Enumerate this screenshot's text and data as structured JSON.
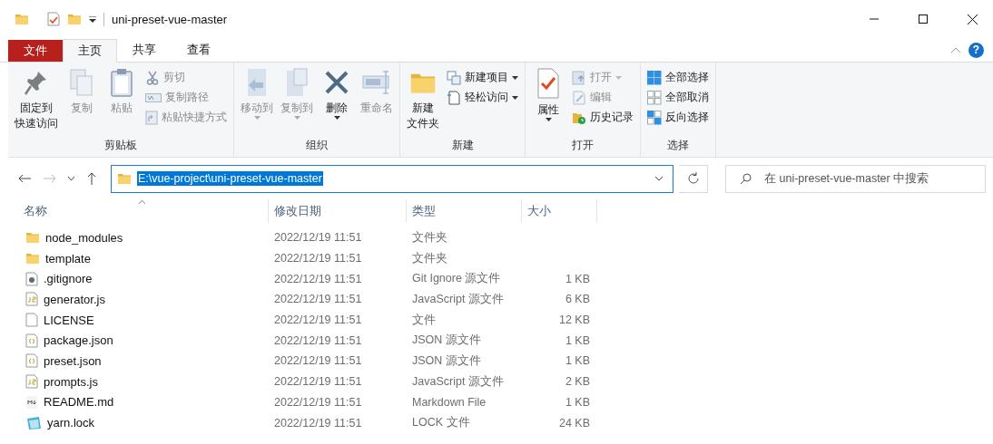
{
  "window": {
    "title": "uni-preset-vue-master"
  },
  "ribbon_tabs": [
    {
      "label": "文件",
      "kind": "file",
      "selected": false
    },
    {
      "label": "主页",
      "kind": "tab",
      "selected": true
    },
    {
      "label": "共享",
      "kind": "tab",
      "selected": false
    },
    {
      "label": "查看",
      "kind": "tab",
      "selected": false
    }
  ],
  "help": "?",
  "ribbon_groups": [
    {
      "label": "剪贴板",
      "items": [
        {
          "kind": "large",
          "lines": [
            "固定到",
            "快速访问"
          ],
          "disabled": false,
          "dropdown": false
        },
        {
          "kind": "large",
          "lines": [
            "复制"
          ],
          "disabled": true,
          "dropdown": false
        },
        {
          "kind": "large",
          "lines": [
            "粘贴"
          ],
          "disabled": true,
          "dropdown": false
        },
        {
          "kind": "small",
          "label": "剪切",
          "disabled": true,
          "dropdown": false
        },
        {
          "kind": "small",
          "label": "复制路径",
          "disabled": true,
          "dropdown": false
        },
        {
          "kind": "small",
          "label": "粘贴快捷方式",
          "disabled": true,
          "dropdown": false
        }
      ]
    },
    {
      "label": "组织",
      "items": [
        {
          "kind": "large",
          "lines": [
            "移动到"
          ],
          "disabled": true,
          "dropdown": true
        },
        {
          "kind": "large",
          "lines": [
            "复制到"
          ],
          "disabled": true,
          "dropdown": true
        },
        {
          "kind": "large",
          "lines": [
            "删除"
          ],
          "disabled": false,
          "dropdown": true
        },
        {
          "kind": "large",
          "lines": [
            "重命名"
          ],
          "disabled": true,
          "dropdown": false
        }
      ]
    },
    {
      "label": "新建",
      "items": [
        {
          "kind": "large",
          "lines": [
            "新建",
            "文件夹"
          ],
          "disabled": false,
          "dropdown": false
        },
        {
          "kind": "small",
          "label": "新建项目",
          "disabled": false,
          "dropdown": true
        },
        {
          "kind": "small",
          "label": "轻松访问",
          "disabled": false,
          "dropdown": true
        }
      ]
    },
    {
      "label": "打开",
      "items": [
        {
          "kind": "large",
          "lines": [
            "属性"
          ],
          "disabled": false,
          "dropdown": true
        },
        {
          "kind": "small",
          "label": "打开",
          "disabled": true,
          "dropdown": true
        },
        {
          "kind": "small",
          "label": "编辑",
          "disabled": true,
          "dropdown": false
        },
        {
          "kind": "small",
          "label": "历史记录",
          "disabled": false,
          "dropdown": false
        }
      ]
    },
    {
      "label": "选择",
      "items": [
        {
          "kind": "small",
          "label": "全部选择",
          "disabled": false,
          "dropdown": false
        },
        {
          "kind": "small",
          "label": "全部取消",
          "disabled": false,
          "dropdown": false
        },
        {
          "kind": "small",
          "label": "反向选择",
          "disabled": false,
          "dropdown": false
        }
      ]
    }
  ],
  "address_bar": {
    "path": "E:\\vue-project\\uni-preset-vue-master",
    "selected": true
  },
  "search": {
    "placeholder": "在 uni-preset-vue-master 中搜索"
  },
  "table": {
    "columns": [
      "名称",
      "修改日期",
      "类型",
      "大小"
    ],
    "rows": [
      {
        "kind": "folder",
        "name": "node_modules",
        "modified": "2022/12/19 11:51",
        "type": "文件夹"
      },
      {
        "kind": "folder",
        "name": "template",
        "modified": "2022/12/19 11:51",
        "type": "文件夹"
      },
      {
        "kind": "config",
        "name": ".gitignore",
        "modified": "2022/12/19 11:51",
        "type": "Git Ignore 源文件",
        "size": "1 KB"
      },
      {
        "kind": "script",
        "name": "generator.js",
        "modified": "2022/12/19 11:51",
        "type": "JavaScript 源文件",
        "size": "6 KB"
      },
      {
        "kind": "blank",
        "name": "LICENSE",
        "modified": "2022/12/19 11:51",
        "type": "文件",
        "size": "12 KB"
      },
      {
        "kind": "json",
        "name": "package.json",
        "modified": "2022/12/19 11:51",
        "type": "JSON 源文件",
        "size": "1 KB"
      },
      {
        "kind": "json",
        "name": "preset.json",
        "modified": "2022/12/19 11:51",
        "type": "JSON 源文件",
        "size": "1 KB"
      },
      {
        "kind": "script",
        "name": "prompts.js",
        "modified": "2022/12/19 11:51",
        "type": "JavaScript 源文件",
        "size": "2 KB"
      },
      {
        "kind": "markdown",
        "name": "README.md",
        "modified": "2022/12/19 11:51",
        "type": "Markdown File",
        "size": "1 KB"
      },
      {
        "kind": "lock",
        "name": "yarn.lock",
        "modified": "2022/12/19 11:51",
        "type": "LOCK 文件",
        "size": "24 KB"
      }
    ]
  }
}
